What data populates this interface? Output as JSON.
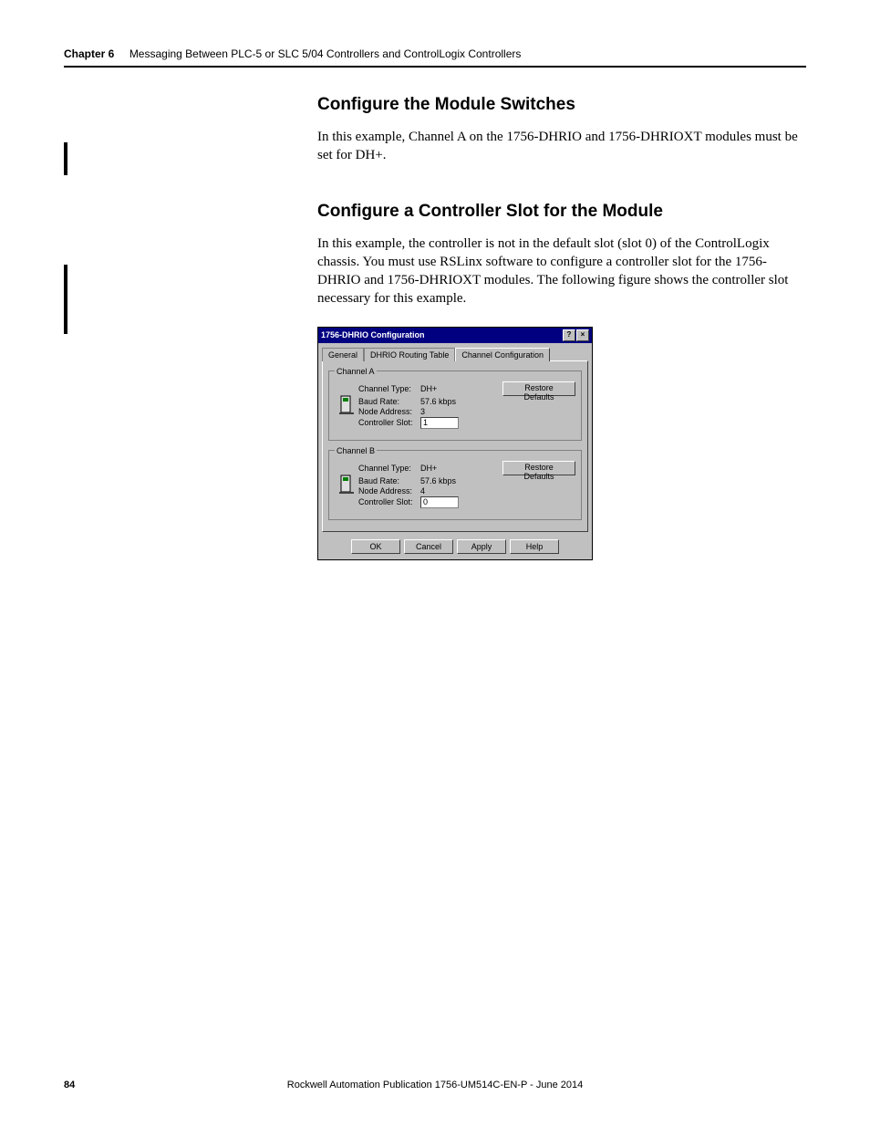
{
  "header": {
    "chapter_label": "Chapter 6",
    "chapter_title": "Messaging Between PLC-5 or SLC 5/04 Controllers and ControlLogix Controllers"
  },
  "section1": {
    "heading": "Configure the Module Switches",
    "para": "In this example, Channel A on the 1756-DHRIO and 1756-DHRIOXT modules must be set for DH+."
  },
  "section2": {
    "heading": "Configure a Controller Slot for the Module",
    "para": "In this example, the controller is not in the default slot (slot 0) of the ControlLogix chassis. You must use RSLinx software to configure a controller slot for the 1756-DHRIO and 1756-DHRIOXT modules. The following figure shows the controller slot necessary for this example."
  },
  "dialog": {
    "title": "1756-DHRIO Configuration",
    "tabs": {
      "general": "General",
      "routing": "DHRIO Routing Table",
      "channel": "Channel Configuration"
    },
    "labels": {
      "channel_type": "Channel Type:",
      "baud_rate": "Baud Rate:",
      "node_address": "Node Address:",
      "controller_slot": "Controller Slot:",
      "restore": "Restore Defaults"
    },
    "channelA": {
      "legend": "Channel A",
      "type": "DH+",
      "baud": "57.6 kbps",
      "node": "3",
      "slot": "1"
    },
    "channelB": {
      "legend": "Channel B",
      "type": "DH+",
      "baud": "57.6 kbps",
      "node": "4",
      "slot": "0"
    },
    "buttons": {
      "ok": "OK",
      "cancel": "Cancel",
      "apply": "Apply",
      "help": "Help"
    }
  },
  "footer": {
    "page": "84",
    "pub": "Rockwell Automation Publication 1756-UM514C-EN-P - June 2014"
  }
}
